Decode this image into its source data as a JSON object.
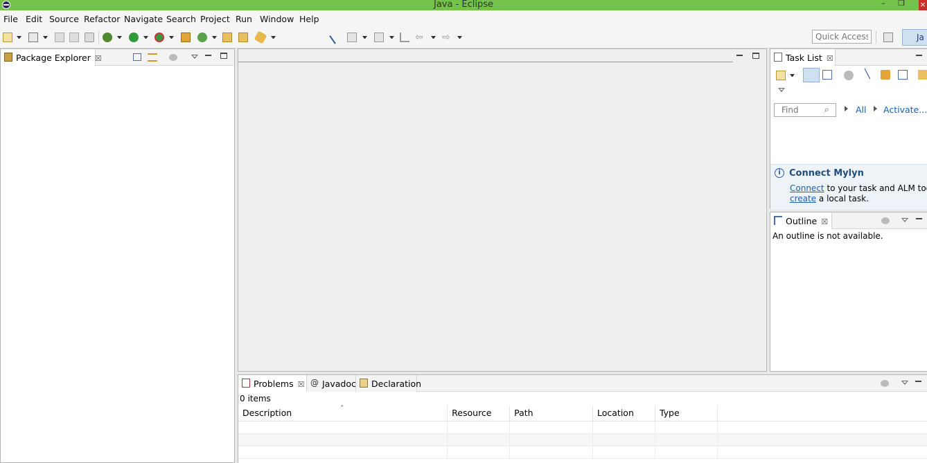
{
  "window": {
    "title": "Java - Eclipse",
    "minimize_glyph": "–",
    "restore_glyph": "❐",
    "close_glyph": "×"
  },
  "menu": [
    "File",
    "Edit",
    "Source",
    "Refactor",
    "Navigate",
    "Search",
    "Project",
    "Run",
    "Window",
    "Help"
  ],
  "toolbar": {
    "quick_access_placeholder": "Quick Access",
    "perspective_label": "Ja",
    "icons": [
      "new-icon",
      "new-package-icon",
      "save-icon",
      "save-all-icon",
      "print-icon",
      "debug-icon",
      "run-icon",
      "coverage-icon",
      "new-java-project-icon",
      "new-class-icon",
      "open-type-icon",
      "open-task-icon",
      "search-icon",
      "toggle-mark-icon",
      "next-annotation-icon",
      "prev-annotation-icon",
      "last-edit-icon",
      "back-icon",
      "forward-icon",
      "open-perspective-icon"
    ]
  },
  "package_explorer": {
    "tab_label": "Package Explorer",
    "close_glyph": "☒"
  },
  "task_list": {
    "tab_label": "Task List",
    "close_glyph": "☒",
    "find_placeholder": "Find",
    "filter_all": "All",
    "activate": "Activate...",
    "connect_title": "Connect Mylyn",
    "connect_link": "Connect",
    "connect_text": " to your task and ALM tools or",
    "create_link": "create",
    "create_text": " a local task."
  },
  "outline": {
    "tab_label": "Outline",
    "close_glyph": "☒",
    "message": "An outline is not available."
  },
  "bottom": {
    "tabs": [
      {
        "label": "Problems",
        "close_glyph": "☒"
      },
      {
        "label": "Javadoc"
      },
      {
        "label": "Declaration"
      }
    ],
    "count": "0 items",
    "columns": [
      "Description",
      "Resource",
      "Path",
      "Location",
      "Type"
    ],
    "sort_glyph": "ˆ"
  },
  "colors": {
    "title_bar": "#73c24a",
    "link": "#1c5fb0",
    "close": "#c9302c"
  }
}
